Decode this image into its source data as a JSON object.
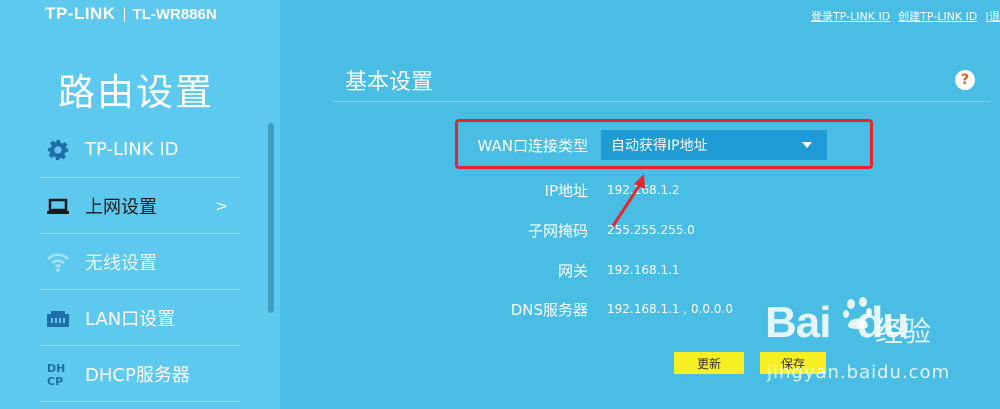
{
  "brand": {
    "logo": "TP-LINK",
    "model": "TL-WR886N"
  },
  "header_links": {
    "login": "登录TP-LINK ID",
    "create": "创建TP-LINK ID",
    "exit": "|退"
  },
  "sidebar": {
    "title": "路由设置",
    "items": [
      {
        "label": "TP-LINK ID",
        "icon": "gear-icon"
      },
      {
        "label": "上网设置",
        "icon": "laptop-icon",
        "arrow": ">"
      },
      {
        "label": "无线设置",
        "icon": "wifi-icon"
      },
      {
        "label": "LAN口设置",
        "icon": "lan-port-icon"
      },
      {
        "label": "DHCP服务器",
        "icon": "dhcp-icon"
      }
    ]
  },
  "main": {
    "section_title": "基本设置",
    "help": "?",
    "wan_label": "WAN口连接类型",
    "wan_type": "自动获得IP地址",
    "fields": [
      {
        "label": "IP地址",
        "value": "192.168.1.2"
      },
      {
        "label": "子网掩码",
        "value": "255.255.255.0"
      },
      {
        "label": "网关",
        "value": "192.168.1.1"
      },
      {
        "label": "DNS服务器",
        "value": "192.168.1.1 , 0.0.0.0"
      }
    ],
    "refresh_label": "更新",
    "save_label": "保存"
  },
  "watermark": {
    "brand": "Bai",
    "brand2": "du",
    "site": "经验",
    "url": "jingyan.baidu.com"
  },
  "colors": {
    "background": "#49bde3",
    "sidebar": "#5ec9ee",
    "select": "#1f9bd6",
    "button": "#f6f022",
    "highlight": "#e5262e",
    "help": "#e35b25"
  }
}
